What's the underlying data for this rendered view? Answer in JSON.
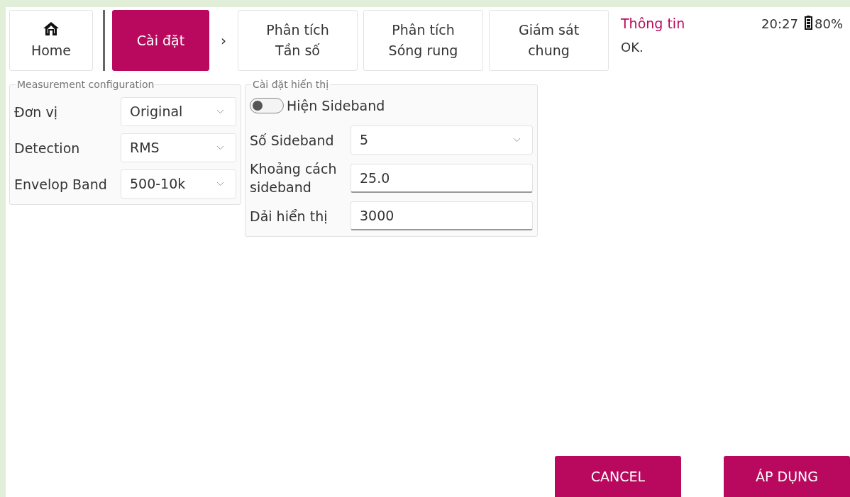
{
  "nav": [
    {
      "kind": "home",
      "label": "Home",
      "selected": false
    },
    {
      "kind": "separator"
    },
    {
      "kind": "tab",
      "label": "Cài đặt",
      "selected": true
    },
    {
      "kind": "chevron",
      "label": "›"
    },
    {
      "kind": "tab",
      "label": "Phân tích\nTần số",
      "selected": false
    },
    {
      "kind": "tab",
      "label": "Phân tích\nSóng rung",
      "selected": false
    },
    {
      "kind": "tab",
      "label": "Giám sát\nchung",
      "selected": false
    }
  ],
  "info": {
    "title": "Thông tin",
    "message": "OK."
  },
  "status": {
    "time": "20:27",
    "battery": "80%"
  },
  "groups": [
    {
      "title": "Measurement configuration",
      "fields": [
        {
          "kind": "select",
          "label": "Đơn vị",
          "value": "Original"
        },
        {
          "kind": "select",
          "label": "Detection",
          "value": "RMS"
        },
        {
          "kind": "select",
          "label": "Envelop Band",
          "value": "500-10k"
        }
      ]
    },
    {
      "title": "Cài đặt hiển thị",
      "fields": [
        {
          "kind": "toggle",
          "label": "Hiện Sideband",
          "on": false
        },
        {
          "kind": "select",
          "label": "Số Sideband",
          "value": "5"
        },
        {
          "kind": "text",
          "label": "Khoảng cách\nsideband",
          "value": "25.0"
        },
        {
          "kind": "text",
          "label": "Dải hiển thị",
          "value": "3000"
        }
      ]
    }
  ],
  "buttons": [
    "CANCEL",
    "ÁP DỤNG"
  ]
}
